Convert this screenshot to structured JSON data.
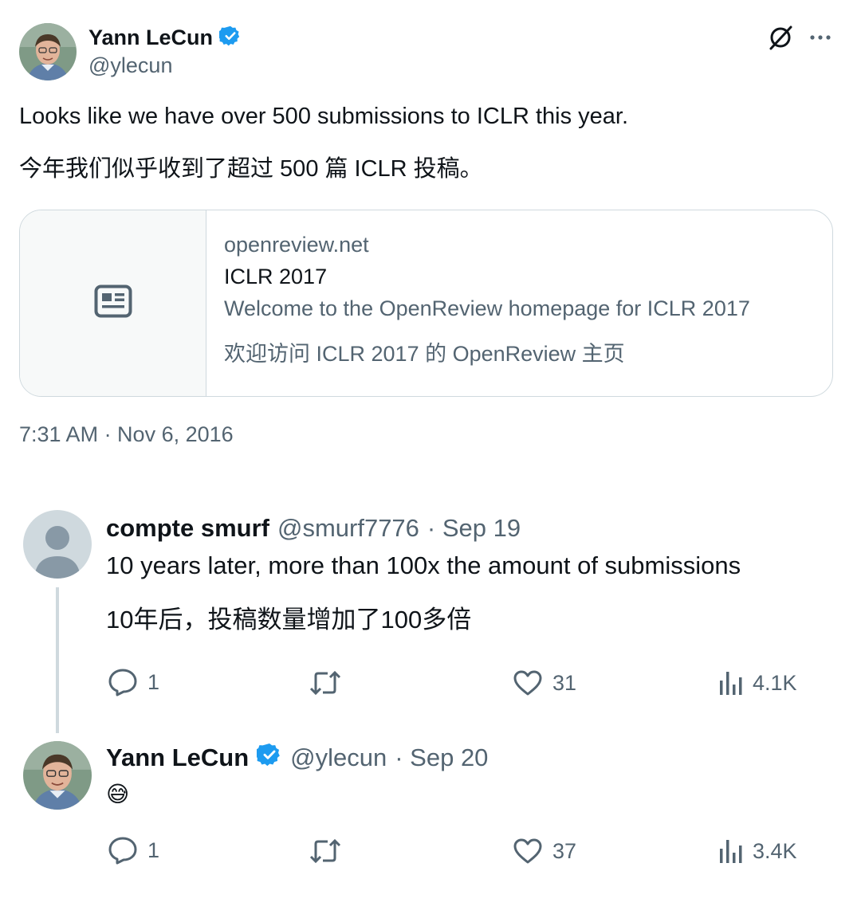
{
  "main_tweet": {
    "author_name": "Yann LeCun",
    "author_handle": "@ylecun",
    "text_en": "Looks like we have over 500 submissions to ICLR this year.",
    "text_zh": "今年我们似乎收到了超过 500 篇 ICLR 投稿。",
    "card": {
      "domain": "openreview.net",
      "title": "ICLR 2017",
      "description_en": "Welcome to the OpenReview homepage for ICLR 2017",
      "description_zh": "欢迎访问 ICLR 2017 的 OpenReview 主页"
    },
    "timestamp": "7:31 AM · Nov 6, 2016"
  },
  "replies": [
    {
      "author_name": "compte smurf",
      "author_handle": "@smurf7776",
      "date": "· Sep 19",
      "text_en": "10 years later, more than 100x the amount of submissions",
      "text_zh": "10年后，投稿数量增加了100多倍",
      "replies_count": "1",
      "likes": "31",
      "views": "4.1K"
    },
    {
      "author_name": "Yann LeCun",
      "author_handle": "@ylecun",
      "date": "· Sep 20",
      "text": "😅",
      "replies_count": "1",
      "likes": "37",
      "views": "3.4K"
    }
  ],
  "icons": {
    "header_right": [
      "grok-icon",
      "more-icon"
    ],
    "verified": "verified-badge-icon",
    "card_media": "article-icon",
    "actions": [
      "reply-icon",
      "retweet-icon",
      "like-icon",
      "views-icon"
    ]
  },
  "colors": {
    "verified_blue": "#1d9bf0",
    "text_primary": "#0f1419",
    "text_secondary": "#536471",
    "border": "#cfd9de"
  }
}
